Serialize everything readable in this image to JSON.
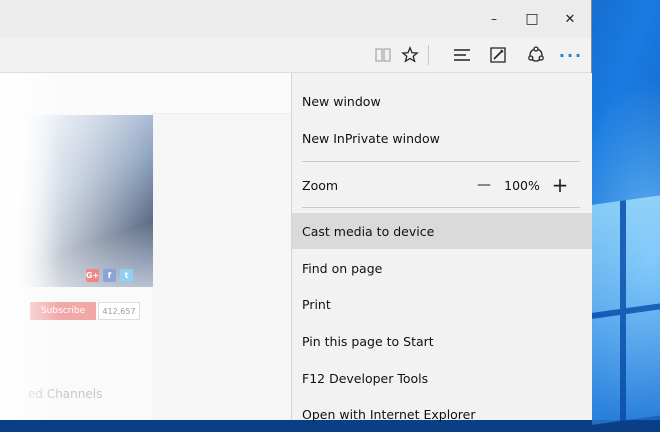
{
  "window": {
    "controls": {
      "minimize": "–",
      "maximize": "□",
      "close": "✕"
    }
  },
  "toolbar": {
    "icons": [
      "reading-view-icon",
      "favorite-star-icon",
      "hub-icon",
      "web-note-icon",
      "share-icon",
      "more-icon"
    ],
    "more_glyph": "···"
  },
  "page": {
    "subscribe_label": "Subscribe",
    "subscriber_count": "412,657",
    "channels_label": "ed Channels",
    "social": [
      "G+",
      "f",
      "t"
    ]
  },
  "menu": {
    "items": [
      {
        "label": "New window"
      },
      {
        "label": "New InPrivate window"
      },
      {
        "label": "Zoom"
      },
      {
        "label": "Cast media to device",
        "highlighted": true
      },
      {
        "label": "Find on page"
      },
      {
        "label": "Print"
      },
      {
        "label": "Pin this page to Start"
      },
      {
        "label": "F12 Developer Tools"
      },
      {
        "label": "Open with Internet Explorer"
      }
    ],
    "zoom": {
      "minus": "—",
      "value": "100%",
      "plus": "+"
    }
  },
  "colors": {
    "accent": "#1e7fd6",
    "menu_bg": "#f2f2f2",
    "menu_hover": "#dadada",
    "desktop": "#0a4da8"
  }
}
